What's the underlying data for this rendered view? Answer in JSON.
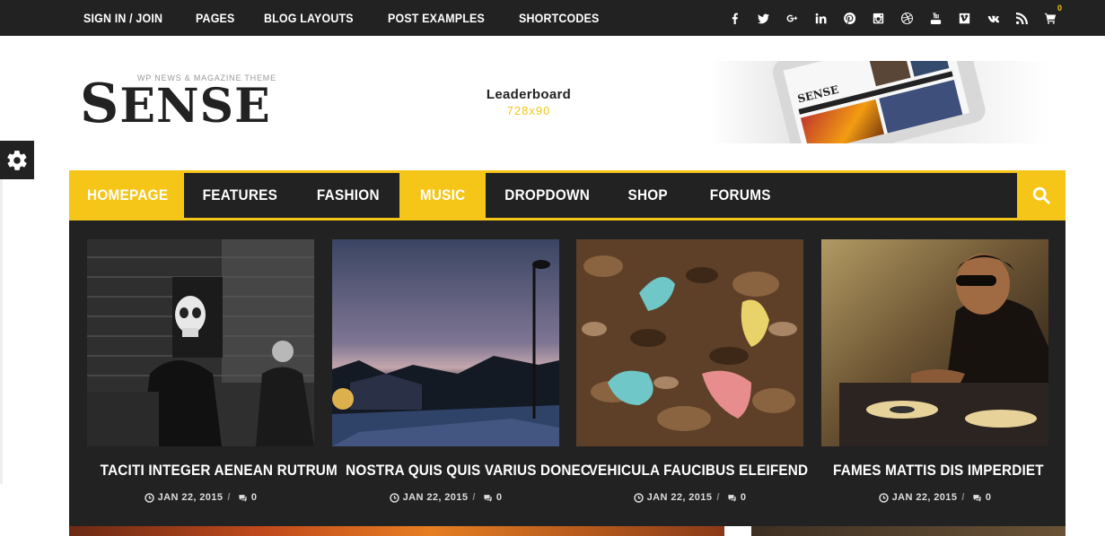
{
  "topbar": {
    "links": [
      "SIGN IN / JOIN",
      "PAGES",
      "BLOG LAYOUTS",
      "POST EXAMPLES",
      "SHORTCODES"
    ],
    "social_icons": [
      "facebook-icon",
      "twitter-icon",
      "google-plus-icon",
      "linkedin-icon",
      "pinterest-icon",
      "instagram-icon",
      "dribbble-icon",
      "youtube-icon",
      "vimeo-icon",
      "vk-icon",
      "rss-icon"
    ],
    "cart_count": "0"
  },
  "header": {
    "logo_text": "SENSE",
    "logo_first": "S",
    "logo_rest": "ENSE",
    "logo_tagline": "WP NEWS & MAGAZINE THEME",
    "leaderboard_title": "Leaderboard",
    "leaderboard_size": "728x90",
    "promo_logo": "SENSE"
  },
  "nav": {
    "items": [
      {
        "label": "HOMEPAGE",
        "active": true
      },
      {
        "label": "FEATURES",
        "active": false
      },
      {
        "label": "FASHION",
        "active": false
      },
      {
        "label": "MUSIC",
        "active": true
      },
      {
        "label": "DROPDOWN",
        "active": false
      },
      {
        "label": "SHOP",
        "active": false
      },
      {
        "label": "FORUMS",
        "active": false
      }
    ]
  },
  "posts": [
    {
      "title": "TACITI INTEGER AENEAN RUTRUM",
      "date": "JAN 22, 2015",
      "comments": "0"
    },
    {
      "title": "NOSTRA QUIS QUIS VARIUS DONEC",
      "date": "JAN 22, 2015",
      "comments": "0"
    },
    {
      "title": "VEHICULA FAUCIBUS ELEIFEND",
      "date": "JAN 22, 2015",
      "comments": "0"
    },
    {
      "title": "FAMES MATTIS DIS IMPERDIET",
      "date": "JAN 22, 2015",
      "comments": "0"
    }
  ],
  "colors": {
    "accent": "#f5c518",
    "dark": "#222222"
  }
}
